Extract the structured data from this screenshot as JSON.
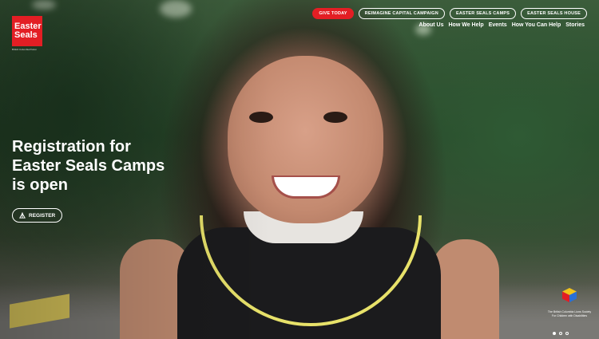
{
  "brand": {
    "logo_line1": "Easter",
    "logo_line2": "Seals",
    "logo_tagline": "British Columbia/Yukon"
  },
  "top_buttons": [
    "GIVE TODAY",
    "REIMAGINE CAPITAL CAMPAIGN",
    "EASTER SEALS CAMPS",
    "EASTER SEALS HOUSE"
  ],
  "nav": [
    "About Us",
    "How We Help",
    "Events",
    "How You Can Help",
    "Stories"
  ],
  "hero": {
    "headline_lines": [
      "Registration for",
      "Easter Seals Camps",
      "is open"
    ],
    "register_label": "REGISTER"
  },
  "partner": {
    "text_lines": [
      "The British Columbia Lions Society",
      "For Children with Disabilities"
    ]
  },
  "carousel": {
    "total": 3,
    "active": 1
  },
  "colors": {
    "brand_red": "#e31e24",
    "text": "#ffffff"
  }
}
